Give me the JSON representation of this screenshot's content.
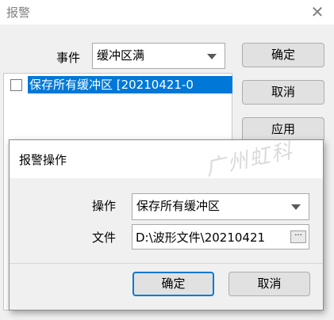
{
  "outer_dialog": {
    "title": "报警",
    "close_glyph": "✕",
    "event_label": "事件",
    "event_value": "缓冲区满",
    "list_items": [
      {
        "text": "保存所有缓冲区  [20210421-0",
        "checked": false,
        "selected": true
      }
    ],
    "buttons": {
      "ok": "确定",
      "cancel": "取消",
      "apply": "应用"
    }
  },
  "inner_dialog": {
    "title": "报警操作",
    "operation_label": "操作",
    "operation_value": "保存所有缓冲区",
    "file_label": "文件",
    "file_value": "D:\\波形文件\\20210421",
    "browse_label": "···",
    "buttons": {
      "ok": "确定",
      "cancel": "取消"
    }
  },
  "watermark": "广州虹科",
  "colors": {
    "selection": "#0078d7",
    "dialog_bg": "#f0f0f0",
    "focus_border": "#0078d7"
  }
}
